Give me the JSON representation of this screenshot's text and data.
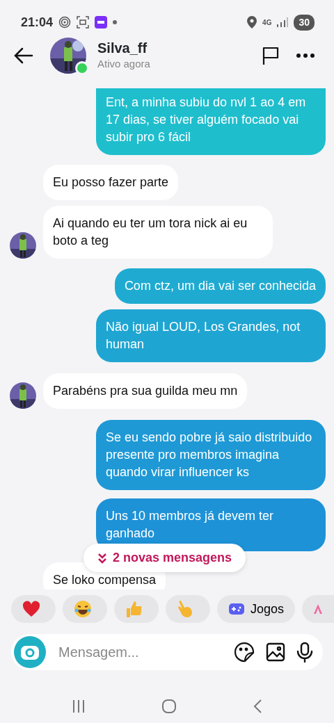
{
  "status_bar": {
    "time": "21:04",
    "network": "4G",
    "battery": "30"
  },
  "header": {
    "name": "Silva_ff",
    "status": "Ativo agora",
    "online": true
  },
  "messages": [
    {
      "kind": "sent",
      "text": "Ent, a minha subiu do nvl 1 ao 4 em 17 dias, se tiver alguém focado vai subir pro 6 fácil"
    },
    {
      "kind": "received",
      "text": "Eu posso fazer parte",
      "show_avatar": false
    },
    {
      "kind": "received",
      "text": "Ai quando eu ter um tora nick ai eu boto a teg",
      "show_avatar": true
    },
    {
      "kind": "sent",
      "text": "Com ctz, um dia vai ser conhecida"
    },
    {
      "kind": "sent",
      "text": "Não igual LOUD, Los Grandes, not human"
    },
    {
      "kind": "received",
      "text": "Parabéns pra sua guilda meu mn",
      "show_avatar": true
    },
    {
      "kind": "sent",
      "text": "Se eu sendo pobre já saio distribuido presente pro membros imagina quando virar influencer ks"
    },
    {
      "kind": "sent",
      "text": "Uns 10 membros já devem ter ganhado"
    },
    {
      "kind": "received",
      "text": "Se loko compensa",
      "show_avatar": false
    }
  ],
  "new_messages": "2 novas mensagens",
  "reactions": [
    {
      "kind": "heart"
    },
    {
      "kind": "laugh"
    },
    {
      "kind": "thumbs-up"
    },
    {
      "kind": "point"
    },
    {
      "kind": "games",
      "label": "Jogos"
    },
    {
      "kind": "text-style"
    }
  ],
  "composer": {
    "placeholder": "Mensagem..."
  }
}
